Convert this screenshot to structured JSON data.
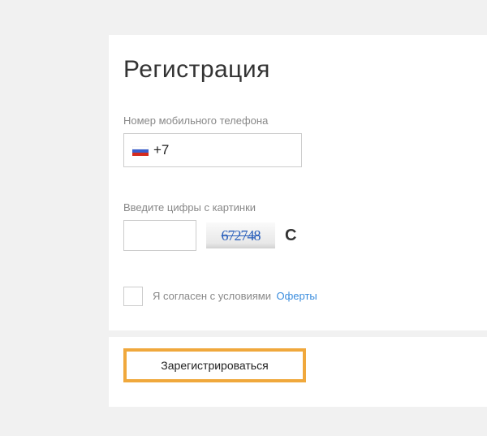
{
  "title": "Регистрация",
  "phone": {
    "label": "Номер мобильного телефона",
    "prefix": "+7",
    "value": ""
  },
  "captcha": {
    "label": "Введите цифры с картинки",
    "image_text": "672748",
    "value": ""
  },
  "consent": {
    "checked": false,
    "text": "Я согласен с условиями",
    "link_text": "Оферты"
  },
  "submit_label": "Зарегистрироваться",
  "colors": {
    "accent": "#f0a83c",
    "link": "#3b8dde"
  }
}
